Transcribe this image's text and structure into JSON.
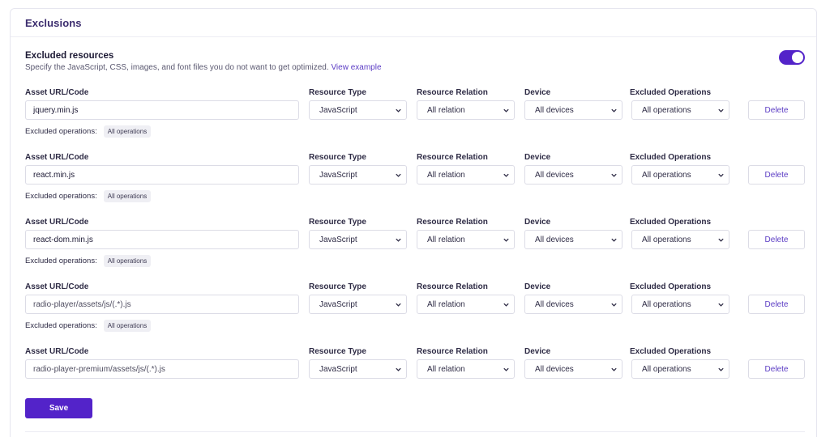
{
  "card": {
    "title": "Exclusions"
  },
  "section": {
    "title": "Excluded resources",
    "description": "Specify the JavaScript, CSS, images, and font files you do not want to get optimized.",
    "link": "View example",
    "enabled": true
  },
  "labels": {
    "asset": "Asset URL/Code",
    "type": "Resource Type",
    "relation": "Resource Relation",
    "device": "Device",
    "operations": "Excluded Operations",
    "excluded_ops": "Excluded operations:",
    "delete": "Delete"
  },
  "rows": [
    {
      "asset": "jquery.min.js",
      "type": "JavaScript",
      "relation": "All relation",
      "device": "All devices",
      "operations": "All operations",
      "chip": "All operations"
    },
    {
      "asset": "react.min.js",
      "type": "JavaScript",
      "relation": "All relation",
      "device": "All devices",
      "operations": "All operations",
      "chip": "All operations"
    },
    {
      "asset": "react-dom.min.js",
      "type": "JavaScript",
      "relation": "All relation",
      "device": "All devices",
      "operations": "All operations",
      "chip": "All operations"
    },
    {
      "asset": "radio-player/assets/js/(.*).js",
      "type": "JavaScript",
      "relation": "All relation",
      "device": "All devices",
      "operations": "All operations",
      "chip": "All operations"
    },
    {
      "asset": "radio-player-premium/assets/js/(.*).js",
      "type": "JavaScript",
      "relation": "All relation",
      "device": "All devices",
      "operations": "All operations"
    }
  ],
  "save_label": "Save",
  "icons": {
    "select_arrow": "chevron-down-icon"
  },
  "colors": {
    "accent": "#5323c9",
    "link": "#5b3cc4"
  }
}
